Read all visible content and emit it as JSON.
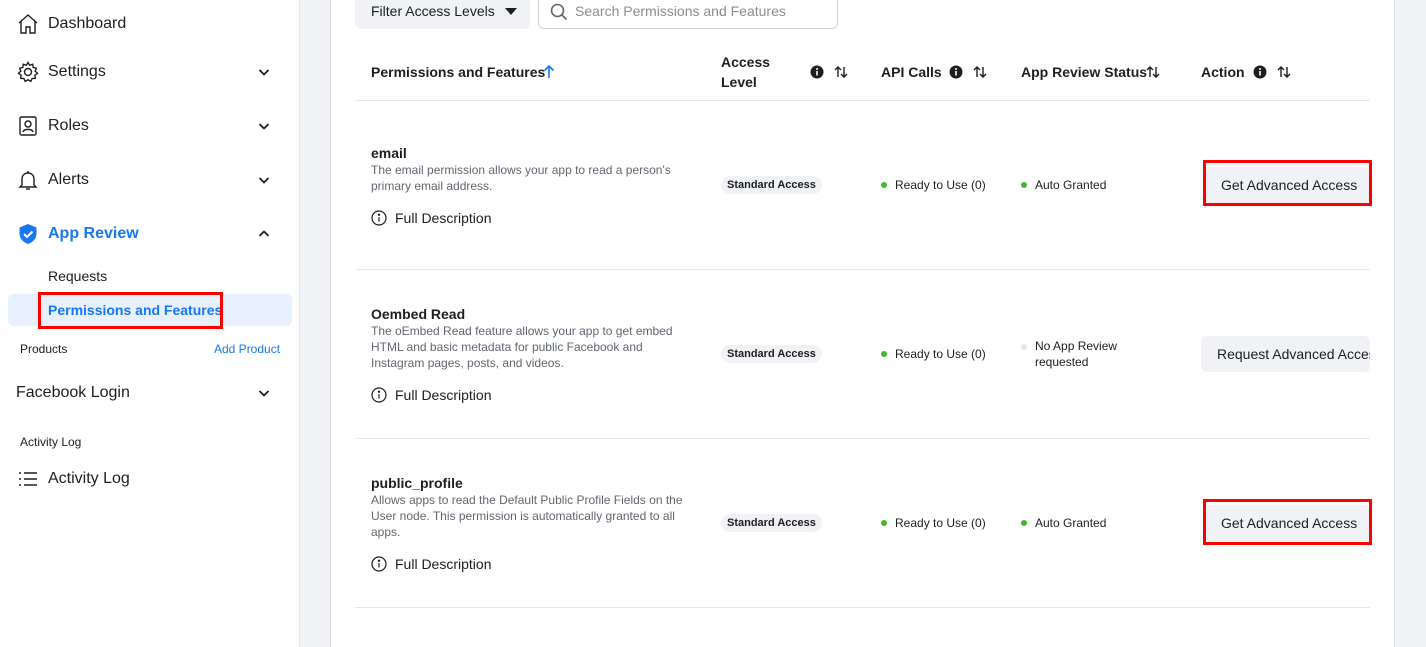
{
  "sidebar": {
    "dashboard": "Dashboard",
    "settings": "Settings",
    "roles": "Roles",
    "alerts": "Alerts",
    "app_review": "App Review",
    "requests": "Requests",
    "permissions_features": "Permissions and Features",
    "products_label": "Products",
    "add_product": "Add Product",
    "facebook_login": "Facebook Login",
    "activity_log_section": "Activity Log",
    "activity_log": "Activity Log"
  },
  "toolbar": {
    "filter_label": "Filter Access Levels",
    "search_placeholder": "Search Permissions and Features"
  },
  "table": {
    "headers": {
      "permissions": "Permissions and Features",
      "access_level_1": "Access",
      "access_level_2": "Level",
      "api_calls": "API Calls",
      "review_status": "App Review Status",
      "action": "Action"
    },
    "rows": [
      {
        "name": "email",
        "description": "The email permission allows your app to read a person's primary email address.",
        "full_description": "Full Description",
        "access": "Standard Access",
        "api_calls": "Ready to Use (0)",
        "review_status": "Auto Granted",
        "action": "Get Advanced Access"
      },
      {
        "name": "Oembed Read",
        "description": "The oEmbed Read feature allows your app to get embed HTML and basic metadata for public Facebook and Instagram pages, posts, and videos.",
        "full_description": "Full Description",
        "access": "Standard Access",
        "api_calls": "Ready to Use (0)",
        "review_status": "No App Review requested",
        "action": "Request Advanced Access"
      },
      {
        "name": "public_profile",
        "description": "Allows apps to read the Default Public Profile Fields on the User node. This permission is automatically granted to all apps.",
        "full_description": "Full Description",
        "access": "Standard Access",
        "api_calls": "Ready to Use (0)",
        "review_status": "Auto Granted",
        "action": "Get Advanced Access"
      }
    ]
  },
  "colors": {
    "accent": "#1877f2",
    "green_dot": "#42b72a",
    "gray_dot": "#e4e6eb",
    "highlight_box": "#ff0000"
  }
}
